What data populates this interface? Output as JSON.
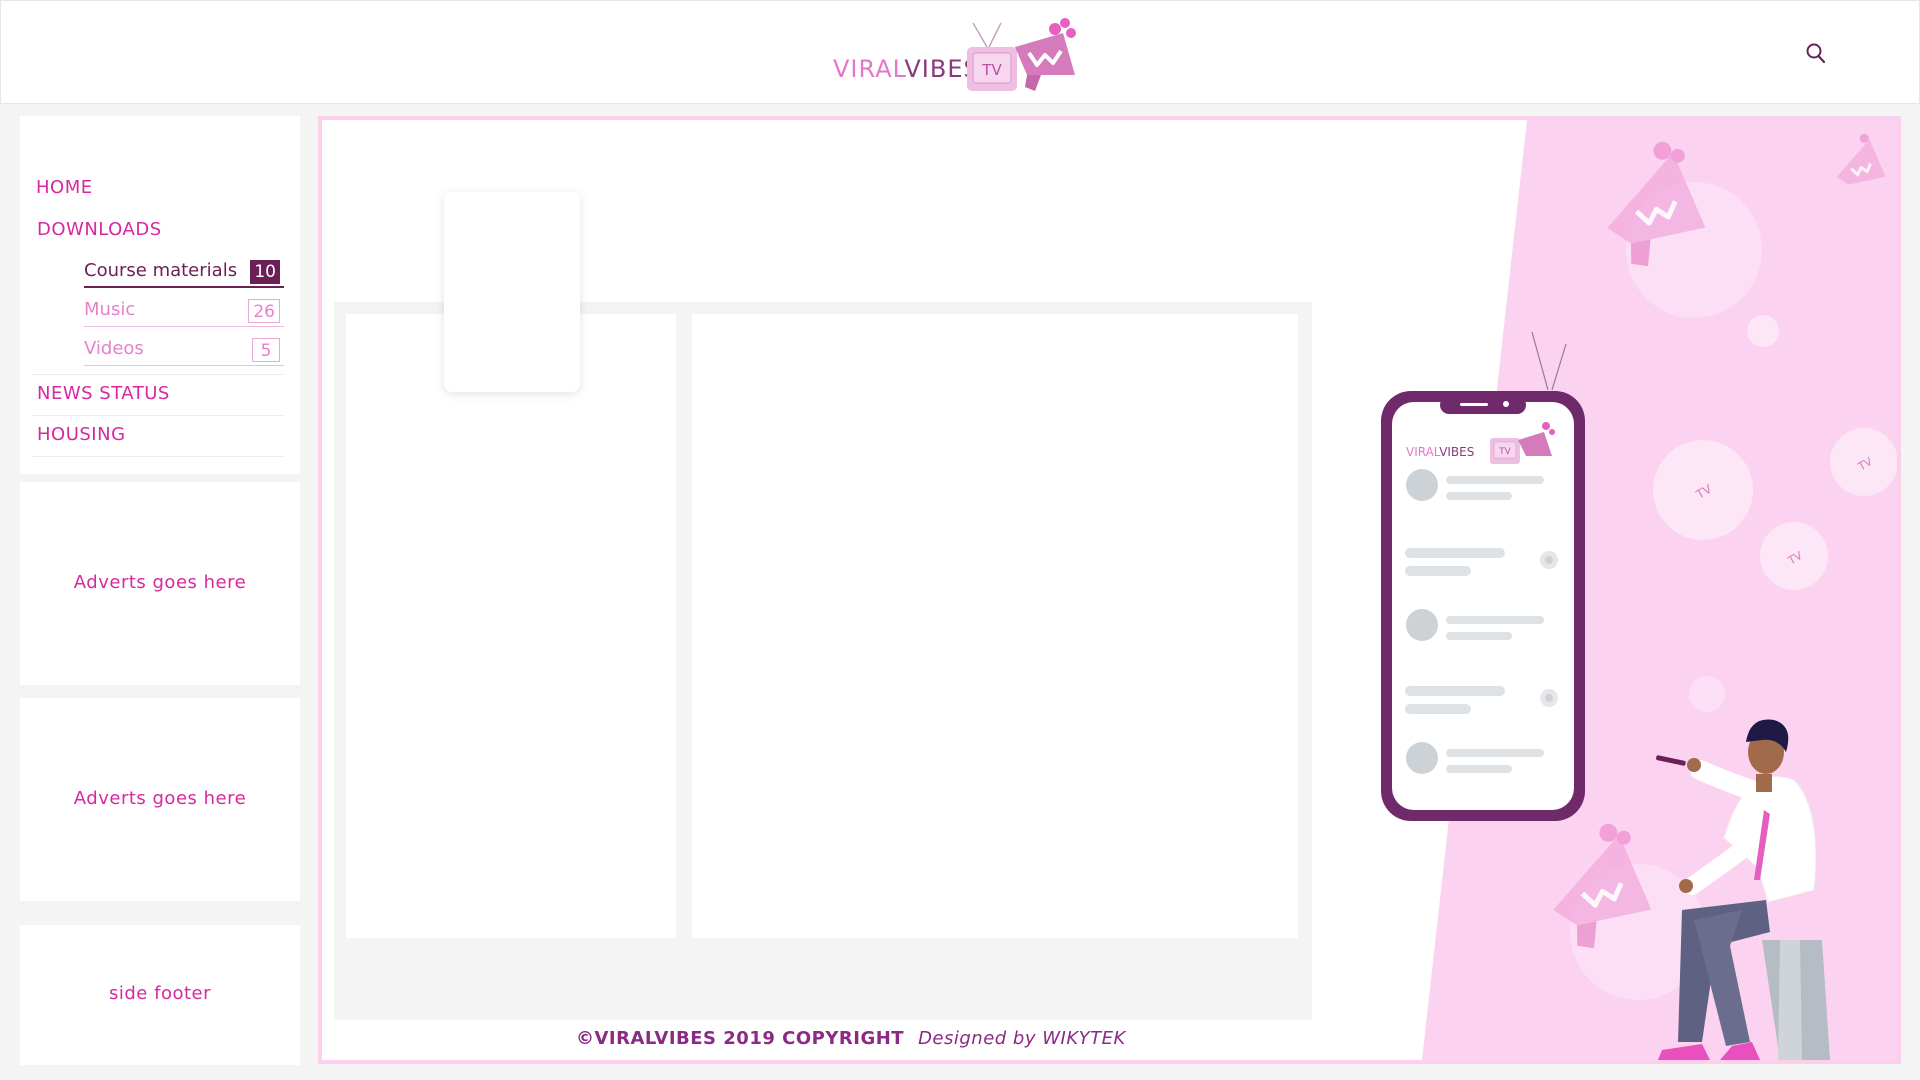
{
  "colors": {
    "accent": "#d6289f",
    "brand_dark": "#6b2158",
    "brand_light": "#fbd0ec",
    "footer_text": "#8a2a86"
  },
  "header": {
    "logo": {
      "part1": "VIRAL",
      "part2": "VIBES",
      "tv": "TV"
    },
    "search_icon": "search-icon"
  },
  "sidebar": {
    "nav": [
      {
        "label": "HOME"
      },
      {
        "label": "DOWNLOADS"
      },
      {
        "label": "NEWS STATUS"
      },
      {
        "label": "HOUSING"
      }
    ],
    "downloads": [
      {
        "label": "Course materials",
        "count": "10",
        "active": true
      },
      {
        "label": "Music",
        "count": "26",
        "active": false
      },
      {
        "label": "Videos",
        "count": "5",
        "active": false
      }
    ],
    "adverts": [
      "Adverts goes here",
      "Adverts goes here"
    ],
    "side_footer": "side footer"
  },
  "main": {
    "phone_logo": {
      "part1": "VIRAL",
      "part2": "VIBES",
      "tv": "TV"
    },
    "tv_badge": "TV",
    "footer": {
      "copyright": "©VIRALVIBES 2019 COPYRIGHT",
      "designed_by": "Designed by WIKYTEK"
    }
  }
}
